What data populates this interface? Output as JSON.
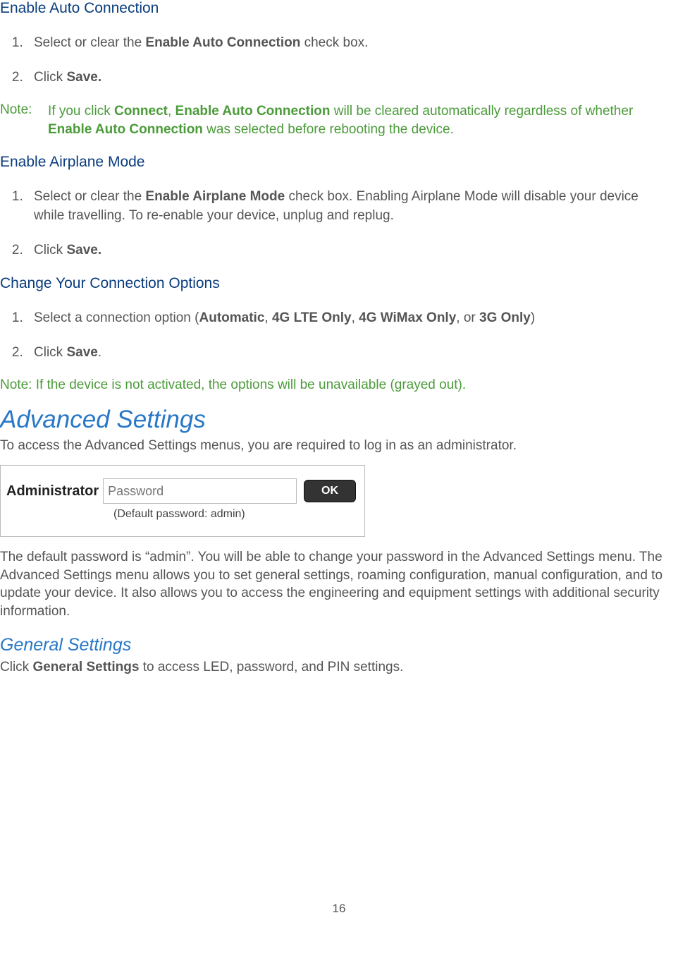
{
  "section1": {
    "title": "Enable Auto Connection",
    "steps": [
      {
        "pre": "Select or clear the ",
        "bold": "Enable Auto Connection",
        "post": " check box."
      },
      {
        "pre": "Click ",
        "bold": "Save.",
        "post": ""
      }
    ]
  },
  "note1": {
    "label": "Note:",
    "pre": "If you click ",
    "b1": "Connect",
    "mid1": ", ",
    "b2": "Enable Auto Connection",
    "mid2": " will be cleared automatically regardless of whether ",
    "b3": "Enable Auto Connection",
    "post": " was selected before rebooting the device."
  },
  "section2": {
    "title": "Enable Airplane Mode",
    "steps": [
      {
        "pre": "Select or clear the ",
        "bold": "Enable Airplane Mode",
        "post": " check box.  Enabling Airplane Mode will disable your device while travelling.  To re-enable your device, unplug and replug."
      },
      {
        "pre": "Click ",
        "bold": "Save.",
        "post": ""
      }
    ]
  },
  "section3": {
    "title": "Change Your Connection Options",
    "step1": {
      "pre": "Select a connection option (",
      "b1": "Automatic",
      "s1": ", ",
      "b2": "4G LTE Only",
      "s2": ", ",
      "b3": "4G WiMax Only",
      "s3": ", or ",
      "b4": "3G Only",
      "post": ")"
    },
    "step2": {
      "pre": "Click ",
      "bold": "Save",
      "post": "."
    }
  },
  "note2": "Note: If the device is not activated, the options will be unavailable (grayed out).",
  "advanced": {
    "heading": "Advanced Settings",
    "intro": "To access the Advanced Settings menus, you are required to log in as an administrator.",
    "login": {
      "label": "Administrator",
      "placeholder": "Password",
      "hint": "(Default password: admin)",
      "ok": "OK"
    },
    "body": "The default password is “admin”. You will be able to change your password in the Advanced Settings menu. The Advanced Settings menu allows you to set general settings, roaming configuration, manual configuration, and to update your device. It also allows you to access the engineering and equipment settings with additional security information."
  },
  "general": {
    "heading": "General Settings",
    "pre": "Click ",
    "bold": "General Settings",
    "post": " to access LED, password, and PIN settings."
  },
  "page_number": "16"
}
